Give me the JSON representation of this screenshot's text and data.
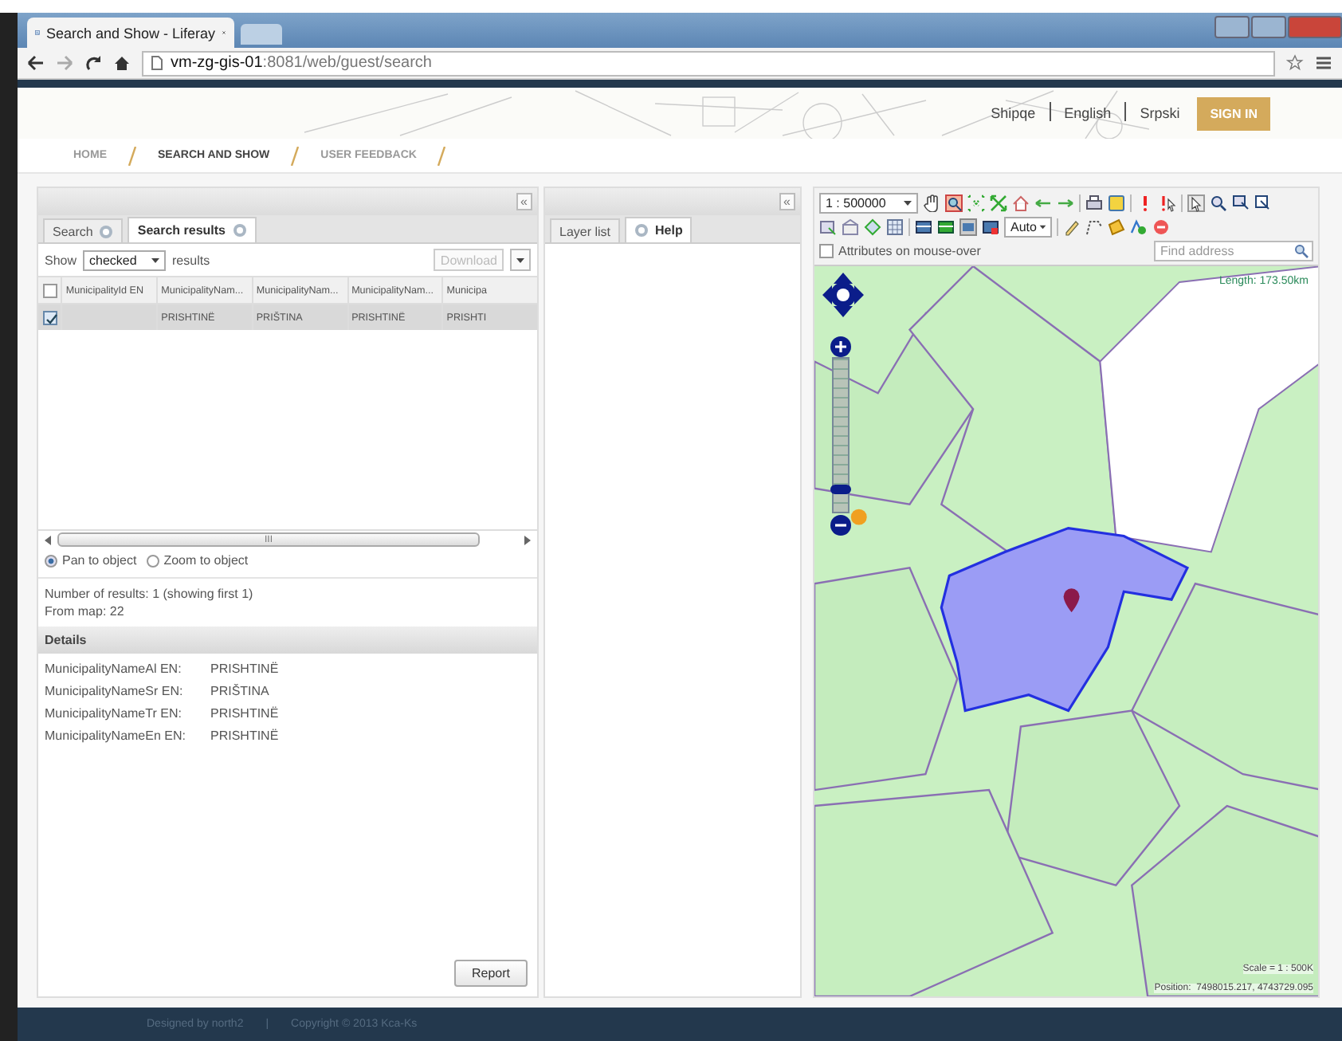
{
  "browser": {
    "tab_title": "Search and Show - Liferay",
    "url_host": "vm-zg-gis-01",
    "url_rest": ":8081/web/guest/search"
  },
  "header": {
    "languages": [
      "Shipqe",
      "English",
      "Srpski"
    ],
    "sign_in": "SIGN IN"
  },
  "breadcrumb": [
    {
      "label": "HOME",
      "selected": false
    },
    {
      "label": "SEARCH AND SHOW",
      "selected": true
    },
    {
      "label": "USER FEEDBACK",
      "selected": false
    }
  ],
  "search_panel": {
    "collapse": "«",
    "tabs": [
      {
        "label": "Search",
        "selected": false
      },
      {
        "label": "Search results",
        "selected": true
      }
    ],
    "show_label": "Show",
    "show_value": "checked",
    "results_label": "results",
    "download": {
      "label": "Download",
      "disabled": true
    },
    "header_checked": false,
    "columns": [
      "MunicipalityId EN",
      "MunicipalityNam...",
      "MunicipalityNam...",
      "MunicipalityNam...",
      "Municipa"
    ],
    "rows": [
      {
        "checked": true,
        "selected": true,
        "cells": [
          "",
          "PRISHTINË",
          "PRIŠTINA",
          "PRISHTINË",
          "PRISHTI"
        ]
      }
    ],
    "scroll_mark": "III",
    "radios": [
      {
        "label": "Pan to object",
        "selected": true
      },
      {
        "label": "Zoom to object",
        "selected": false
      }
    ],
    "summary": [
      "Number of results: 1 (showing first 1)",
      "From map: 22"
    ],
    "details_title": "Details",
    "details": [
      {
        "label": "MunicipalityNameAl EN:",
        "value": "PRISHTINË"
      },
      {
        "label": "MunicipalityNameSr EN:",
        "value": "PRIŠTINA"
      },
      {
        "label": "MunicipalityNameTr EN:",
        "value": "PRISHTINË"
      },
      {
        "label": "MunicipalityNameEn EN:",
        "value": "PRISHTINË"
      }
    ],
    "report": "Report"
  },
  "layer_panel": {
    "collapse": "«",
    "tabs": [
      {
        "label": "Layer list",
        "selected": false
      },
      {
        "label": "Help",
        "selected": true
      }
    ]
  },
  "map": {
    "scale_value": "1 : 500000",
    "auto_value": "Auto",
    "attributes_label": "Attributes on mouse-over",
    "attributes_checked": false,
    "find_placeholder": "Find address",
    "length": "Length: 173.50km",
    "zoom": {
      "level": 0.15
    },
    "scale_text": "Scale = 1 : 500K",
    "position": "Position:  7498015.217, 4743729.095"
  },
  "footer": {
    "designed": "Designed by north2",
    "separator": "|",
    "copyright": "Copyright © 2013 Kca-Ks"
  }
}
